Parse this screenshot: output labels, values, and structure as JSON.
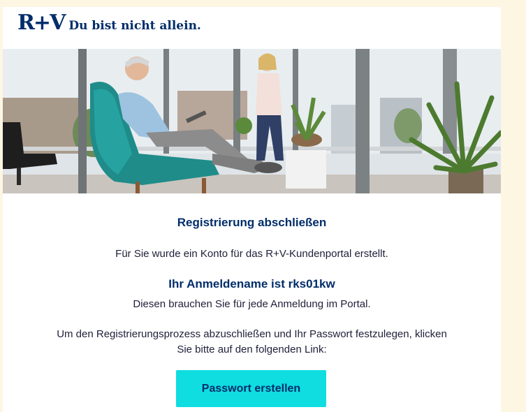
{
  "header": {
    "logo_text": "R+V",
    "tagline": "Du bist nicht allein."
  },
  "hero": {
    "image": "hero-photo-living-room"
  },
  "content": {
    "heading": "Registrierung abschließen",
    "line1": "Für Sie wurde ein Konto für das R+V-Kundenportal erstellt.",
    "username": "Ihr Anmeldename ist rks01kw",
    "line2": "Diesen brauchen Sie für jede Anmeldung im Portal.",
    "line3a": "Um den Registrierungsprozess abzuschließen und Ihr Passwort festzulegen, klicken",
    "line3b": "Sie bitte auf den folgenden Link:",
    "button_label": "Passwort erstellen"
  },
  "colors": {
    "brand_blue": "#002d6a",
    "button_cyan": "#10dde0",
    "outer_bg": "#fdf6e3"
  }
}
